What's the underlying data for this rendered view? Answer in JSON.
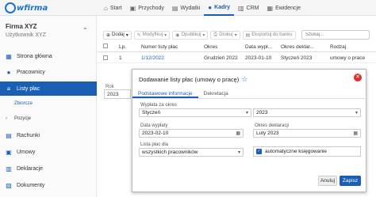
{
  "brand": {
    "logo_text": "wfirma"
  },
  "nav": [
    {
      "label": "Start",
      "icon": "home-icon"
    },
    {
      "label": "Przychody",
      "icon": "cart-icon"
    },
    {
      "label": "Wydatki",
      "icon": "document-icon"
    },
    {
      "label": "Kadry",
      "icon": "people-icon"
    },
    {
      "label": "CRM",
      "icon": "crm-icon"
    },
    {
      "label": "Ewidencje",
      "icon": "folder-icon"
    }
  ],
  "sidebar": {
    "company": "Firma XYZ",
    "user": "Użytkownik XYZ",
    "items": [
      {
        "label": "Strona główna"
      },
      {
        "label": "Pracownicy"
      },
      {
        "label": "Listy płac"
      },
      {
        "label": "Zbiorcze"
      },
      {
        "label": "Pozycje"
      },
      {
        "label": "Rachunki"
      },
      {
        "label": "Umowy"
      },
      {
        "label": "Deklaracje"
      },
      {
        "label": "Dokumenty"
      }
    ]
  },
  "toolbar": {
    "add": "Dodaj",
    "modify": "Modyfikuj",
    "publish": "Opublikuj",
    "print": "Drukuj",
    "export": "Eksportuj do banku",
    "search_placeholder": "Szukaj..."
  },
  "table": {
    "headers": [
      "Lp.",
      "Numer listy płac",
      "Okres",
      "Data wypł...",
      "Okres deklar...",
      "Rodzaj"
    ],
    "rows": [
      {
        "lp": "1",
        "number": "1/12/2022",
        "period": "Grudzień 2022",
        "date": "2023-01-10",
        "decl": "Styczeń 2023",
        "type": "umowy o prace"
      }
    ]
  },
  "year_filter": {
    "label": "Rok",
    "value": "2023"
  },
  "modal": {
    "title": "Dodawanie listy płac (umowy o pracę)",
    "tabs": [
      "Podstawowe informacje",
      "Dekretacja"
    ],
    "payout_label": "Wypłata za okres",
    "payout_month": "Styczeń",
    "payout_year": "2023",
    "pay_date_label": "Data wypłaty",
    "pay_date": "2023-02-10",
    "decl_label": "Okres deklaracji",
    "decl_value": "Luty 2023",
    "list_for_label": "Lista płac dla",
    "list_for_value": "wszystkich pracowników",
    "auto_booking": "automatyczne księgowanie",
    "cancel": "Anuluj",
    "save": "Zapisz"
  }
}
